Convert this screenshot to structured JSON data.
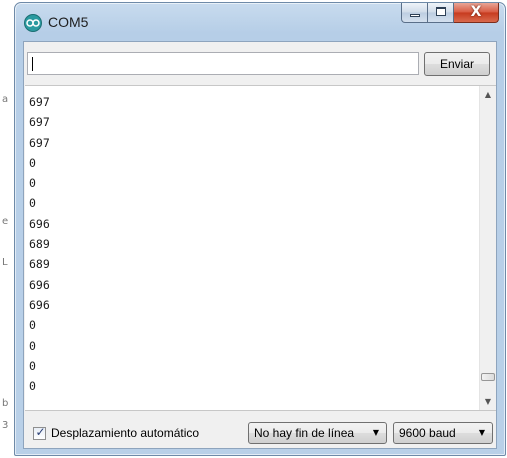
{
  "window": {
    "title": "COM5",
    "close_glyph": "X"
  },
  "send": {
    "input_value": "",
    "button_label": "Enviar"
  },
  "output": {
    "lines": [
      "697",
      "697",
      "697",
      "0",
      "0",
      "0",
      "696",
      "689",
      "689",
      "696",
      "696",
      "0",
      "0",
      "0",
      "0"
    ]
  },
  "footer": {
    "autoscroll_label": "Desplazamiento automático",
    "autoscroll_checked": true,
    "line_ending_value": "No hay fin de línea",
    "baud_value": "9600 baud"
  },
  "background_chars": [
    "a",
    "e",
    "L",
    "b",
    "3"
  ],
  "colors": {
    "titlebar": "#b9d0e8",
    "close_button": "#c63a1e",
    "app_icon": "#2a9aa0"
  }
}
